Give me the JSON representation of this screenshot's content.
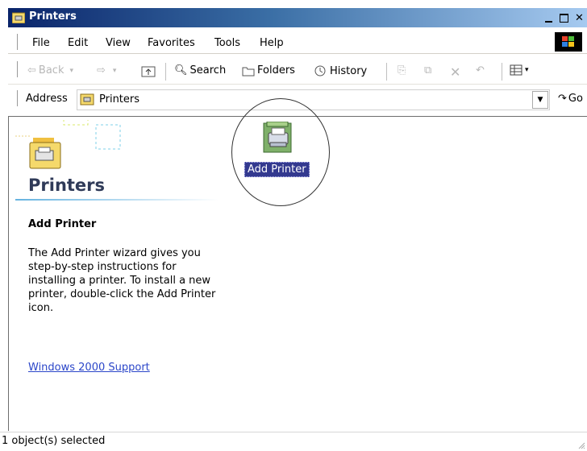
{
  "window": {
    "title": "Printers"
  },
  "menu": [
    "File",
    "Edit",
    "View",
    "Favorites",
    "Tools",
    "Help"
  ],
  "toolbar": {
    "back": "Back",
    "search": "Search",
    "folders": "Folders",
    "history": "History"
  },
  "address": {
    "label": "Address",
    "value": "Printers",
    "go": "Go"
  },
  "panel": {
    "title": "Printers",
    "heading": "Add Printer",
    "description": "The Add Printer wizard gives you step-by-step instructions for installing a printer. To install a new printer, double-click the Add Printer icon.",
    "link": "Windows 2000 Support"
  },
  "items": [
    {
      "label": "Add Printer",
      "icon": "add-printer-icon",
      "selected": true
    }
  ],
  "status": {
    "text": "1 object(s) selected"
  },
  "colors": {
    "titlebar_start": "#0a246a",
    "titlebar_end": "#a6caf0",
    "selection": "#33398f",
    "link": "#2b46c9",
    "panel_title": "#2f3a58"
  }
}
